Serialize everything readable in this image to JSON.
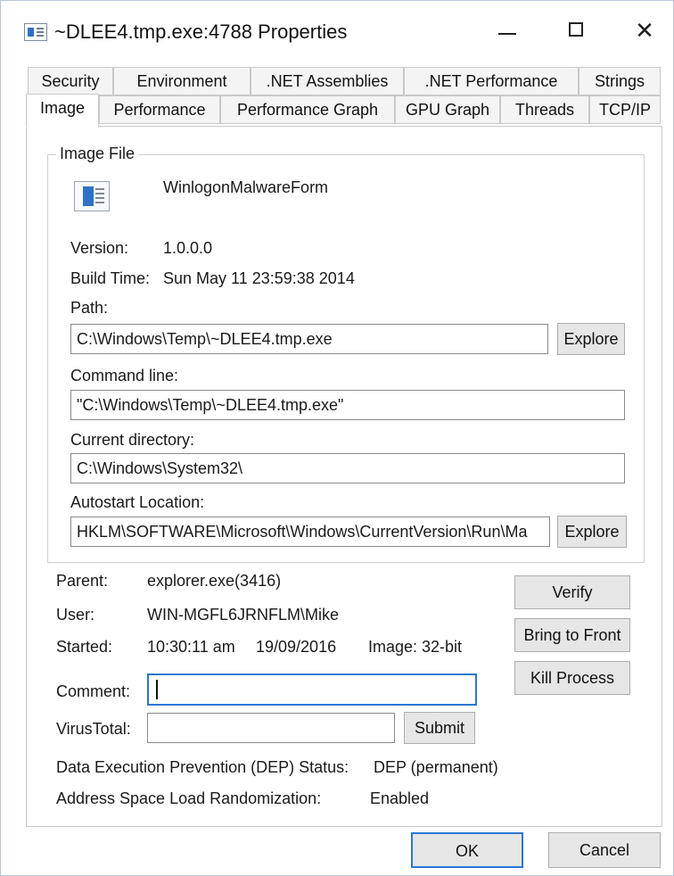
{
  "window": {
    "title": "~DLEE4.tmp.exe:4788 Properties",
    "minimize_glyph": "—",
    "maximize_glyph": "☐",
    "close_glyph": "✕"
  },
  "tabs": {
    "row1": [
      "Security",
      "Environment",
      ".NET Assemblies",
      ".NET Performance",
      "Strings"
    ],
    "row2": [
      "Image",
      "Performance",
      "Performance Graph",
      "GPU Graph",
      "Threads",
      "TCP/IP"
    ],
    "active": "Image"
  },
  "image_file": {
    "group_label": "Image File",
    "icon": "application-window-icon",
    "description": "WinlogonMalwareForm",
    "version_label": "Version:",
    "version": "1.0.0.0",
    "build_time_label": "Build Time:",
    "build_time": "Sun May 11 23:59:38 2014",
    "path_label": "Path:",
    "path": "C:\\Windows\\Temp\\~DLEE4.tmp.exe",
    "explore_label": "Explore",
    "command_line_label": "Command line:",
    "command_line": "\"C:\\Windows\\Temp\\~DLEE4.tmp.exe\"",
    "current_directory_label": "Current directory:",
    "current_directory": "C:\\Windows\\System32\\",
    "autostart_label": "Autostart Location:",
    "autostart": "HKLM\\SOFTWARE\\Microsoft\\Windows\\CurrentVersion\\Run\\Ma",
    "autostart_explore_label": "Explore"
  },
  "process": {
    "parent_label": "Parent:",
    "parent": "explorer.exe(3416)",
    "user_label": "User:",
    "user": "WIN-MGFL6JRNFLM\\Mike",
    "started_label": "Started:",
    "started_time": "10:30:11 am",
    "started_date": "19/09/2016",
    "image_bits": "Image: 32-bit",
    "comment_label": "Comment:",
    "comment_value": "",
    "virustotal_label": "VirusTotal:",
    "virustotal_value": "",
    "submit_label": "Submit",
    "verify_label": "Verify",
    "bring_to_front_label": "Bring to Front",
    "kill_process_label": "Kill Process",
    "dep_label": "Data Execution Prevention (DEP) Status:",
    "dep_value": "DEP (permanent)",
    "aslr_label": "Address Space Load Randomization:",
    "aslr_value": "Enabled"
  },
  "footer": {
    "ok_label": "OK",
    "cancel_label": "Cancel"
  }
}
